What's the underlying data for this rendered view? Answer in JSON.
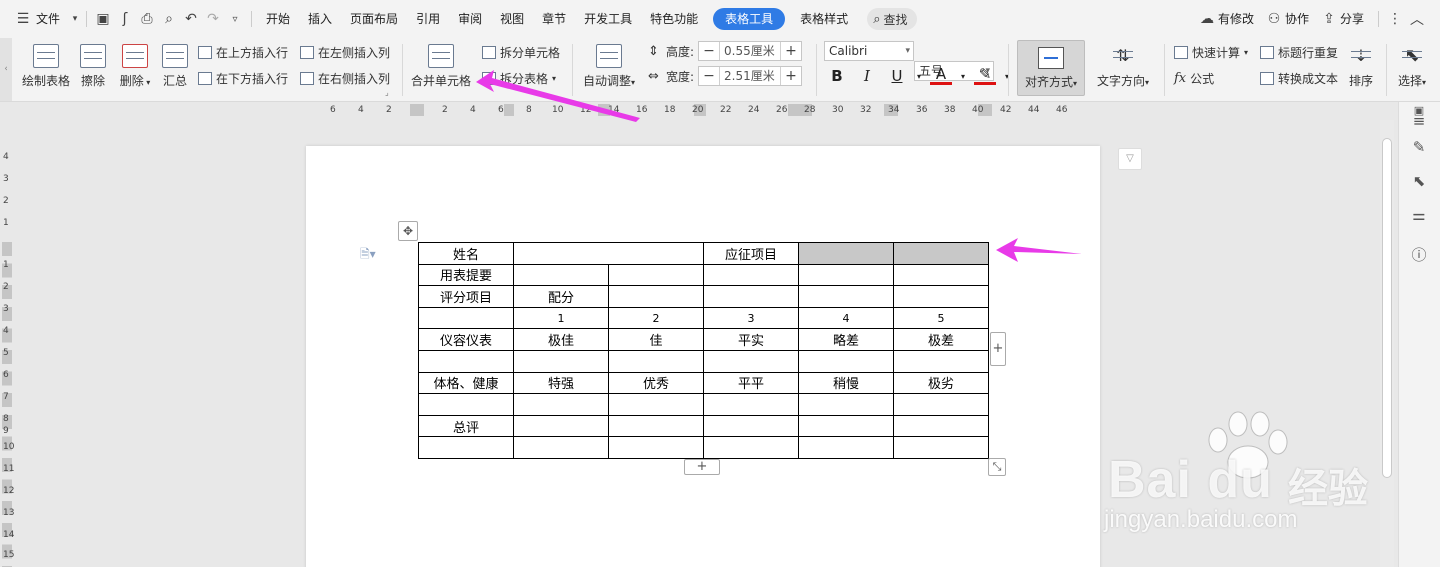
{
  "menubar": {
    "file_label": "文件",
    "tabs": [
      "开始",
      "插入",
      "页面布局",
      "引用",
      "审阅",
      "视图",
      "章节",
      "开发工具",
      "特色功能"
    ],
    "table_tools": "表格工具",
    "table_style": "表格样式",
    "search": "查找",
    "modified": "有修改",
    "collaborate": "协作",
    "share": "分享"
  },
  "ribbon": {
    "draw_table": "绘制表格",
    "erase": "擦除",
    "delete": "删除",
    "summary": "汇总",
    "insert_row_above": "在上方插入行",
    "insert_row_below": "在下方插入行",
    "insert_col_left": "在左侧插入列",
    "insert_col_right": "在右侧插入列",
    "merge_cells": "合并单元格",
    "split_cells": "拆分单元格",
    "split_table": "拆分表格",
    "auto_fit": "自动调整",
    "height_label": "高度:",
    "height_value": "0.55厘米",
    "width_label": "宽度:",
    "width_value": "2.51厘米",
    "font_name": "Calibri",
    "font_size": "五号",
    "align": "对齐方式",
    "text_direction": "文字方向",
    "quick_calc": "快速计算",
    "repeat_header": "标题行重复",
    "formula": "公式",
    "to_text": "转换成文本",
    "sort": "排序",
    "select": "选择"
  },
  "hruler": [
    "6",
    "4",
    "2",
    "2",
    "4",
    "6",
    "8",
    "10",
    "12",
    "14",
    "16",
    "18",
    "20",
    "22",
    "24",
    "26",
    "28",
    "30",
    "32",
    "34",
    "36",
    "38",
    "40",
    "42",
    "44",
    "46"
  ],
  "vruler": [
    "4",
    "3",
    "2",
    "1",
    "1",
    "2",
    "3",
    "4",
    "5",
    "6",
    "7",
    "8",
    "9",
    "10",
    "11",
    "12",
    "13",
    "14",
    "15"
  ],
  "table": {
    "rows": [
      [
        "姓名",
        "",
        "",
        "应征项目",
        "",
        ""
      ],
      [
        "用表提要",
        "",
        "",
        "",
        "",
        ""
      ],
      [
        "评分项目",
        "配分",
        "",
        "",
        "",
        ""
      ],
      [
        "",
        "1",
        "2",
        "3",
        "4",
        "5"
      ],
      [
        "仪容仪表",
        "极佳",
        "佳",
        "平实",
        "略差",
        "极差"
      ],
      [
        "",
        "",
        "",
        "",
        "",
        ""
      ],
      [
        "体格、健康",
        "特强",
        "优秀",
        "平平",
        "稍慢",
        "极劣"
      ],
      [
        "",
        "",
        "",
        "",
        "",
        ""
      ],
      [
        "总评",
        "",
        "",
        "",
        "",
        ""
      ],
      [
        "",
        "",
        "",
        "",
        "",
        ""
      ]
    ]
  },
  "watermark": {
    "brand": "Bai du",
    "cn": "经验",
    "url": "jingyan.baidu.com"
  },
  "colors": {
    "accent": "#2f7be5",
    "arrow": "#e83ae8",
    "selected_cell": "#c8c8c8"
  }
}
